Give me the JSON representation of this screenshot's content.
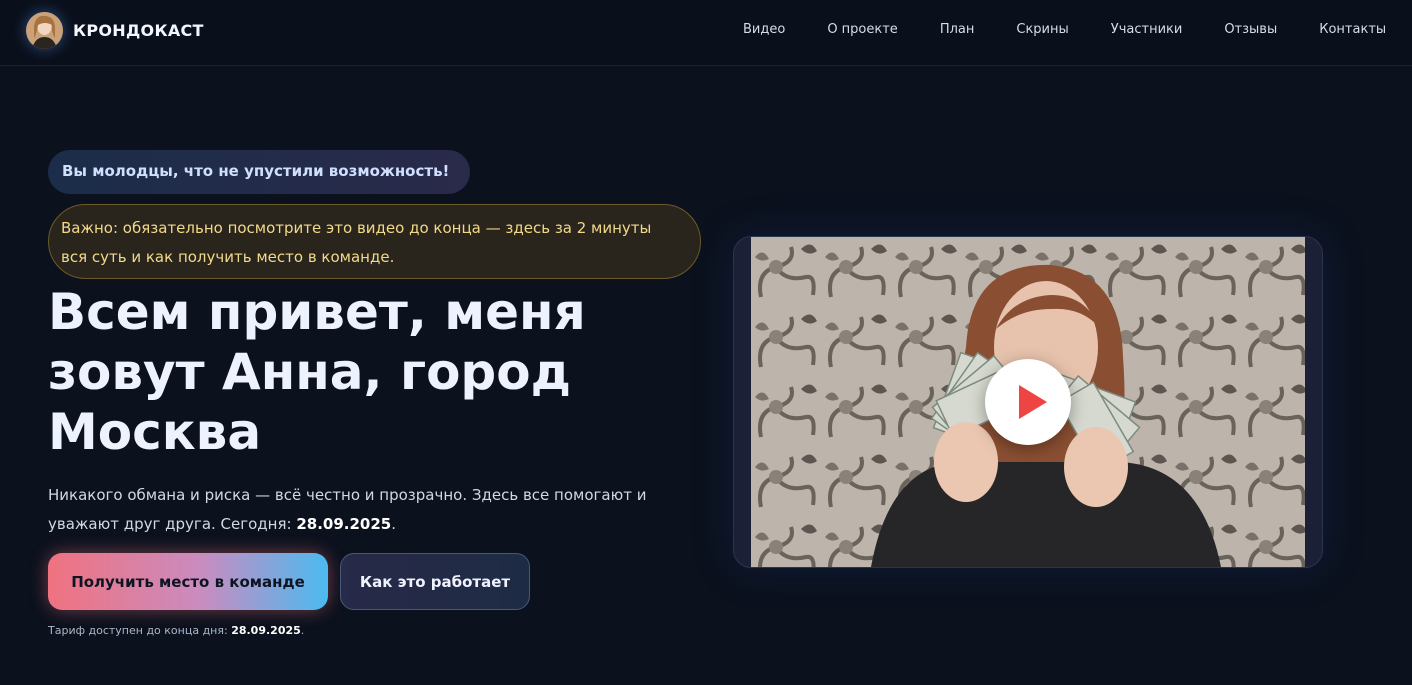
{
  "brand": {
    "name": "КРОНДОКАСТ"
  },
  "nav": {
    "items": [
      "Видео",
      "О проекте",
      "План",
      "Скрины",
      "Участники",
      "Отзывы",
      "Контакты"
    ]
  },
  "hero": {
    "badge": "Вы молодцы, что не упустили возможность!",
    "notice": "Важно: обязательно посмотрите это видео до конца — здесь за 2 минуты вся суть и как получить место в команде.",
    "title": "Всем привет, меня зовут Анна, город Москва",
    "subtitle_text": "Никакого обмана и риска — всё честно и прозрачно. Здесь все помогают и уважают друг друга. Сегодня: ",
    "subtitle_date": "28.09.2025",
    "subtitle_end": ".",
    "primary_button": "Получить место в команде",
    "secondary_button": "Как это работает",
    "tariff_text": "Тариф доступен до конца дня: ",
    "tariff_date": "28.09.2025",
    "tariff_end": "."
  },
  "video": {
    "play_icon": "play-icon"
  },
  "colors": {
    "background": "#0b111d",
    "accent_pink": "#f0727f",
    "accent_blue": "#4bbaf0",
    "notice_text": "#f2d98a",
    "play_red": "#ef4444"
  }
}
